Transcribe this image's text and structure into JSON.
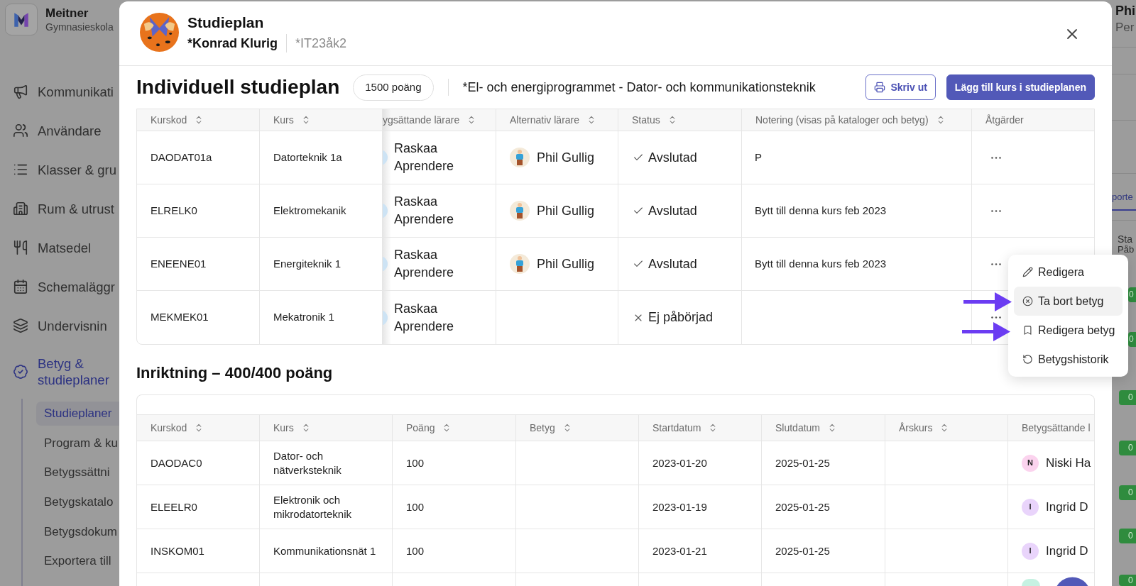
{
  "sidebar": {
    "school_name": "Meitner",
    "school_type": "Gymnasieskola",
    "items": [
      {
        "label": "Kommunikati",
        "selected": false
      },
      {
        "label": "Användare",
        "selected": false
      },
      {
        "label": "Klasser & gru",
        "selected": false
      },
      {
        "label": "Rum & utrust",
        "selected": false
      },
      {
        "label": "Matsedel",
        "selected": false
      },
      {
        "label": "Schemaläggr",
        "selected": false
      },
      {
        "label": "Undervisnin",
        "selected": false
      },
      {
        "label": "Betyg & studieplaner",
        "selected": true,
        "children": [
          {
            "label": "Studieplaner",
            "selected": true
          },
          {
            "label": "Program & ku",
            "selected": false
          },
          {
            "label": "Betygssättni",
            "selected": false
          },
          {
            "label": "Betygskatalo",
            "selected": false
          },
          {
            "label": "Betygsdokum",
            "selected": false
          },
          {
            "label": "Exportera till",
            "selected": false
          }
        ]
      }
    ]
  },
  "dialog": {
    "title": "Studieplan",
    "student": "*Konrad Klurig",
    "class": "*IT23åk2",
    "plan_title": "Individuell studieplan",
    "points": "1500 poäng",
    "program": "*El- och energiprogrammet - Dator- och kommunikationsteknik",
    "buttons": [
      {
        "label": "Skriv ut",
        "kind": "outline"
      },
      {
        "label": "Lägg till kurs i studieplanen",
        "kind": "primary"
      }
    ]
  },
  "courses_table": {
    "columns": [
      {
        "label": "Kurskod",
        "sortable": true
      },
      {
        "label": "Kurs",
        "sortable": true
      },
      {
        "label": "ygsättande lärare",
        "sortable": true
      },
      {
        "label": "Alternativ lärare",
        "sortable": true
      },
      {
        "label": "Status",
        "sortable": true
      },
      {
        "label": "Notering (visas på kataloger och betyg)",
        "sortable": true
      },
      {
        "label": "Åtgärder",
        "sortable": false
      }
    ],
    "rows": [
      {
        "code": "DAODAT01a",
        "course": "Datorteknik 1a",
        "teacher": "Raskaa Aprendere",
        "alt_teacher": "Phil Gullig",
        "status": {
          "kind": "done",
          "label": "Avslutad"
        },
        "note": "P"
      },
      {
        "code": "ELRELK0",
        "course": "Elektromekanik",
        "teacher": "Raskaa Aprendere",
        "alt_teacher": "Phil Gullig",
        "status": {
          "kind": "done",
          "label": "Avslutad"
        },
        "note": "Bytt till denna kurs feb 2023"
      },
      {
        "code": "ENEENE01",
        "course": "Energiteknik 1",
        "teacher": "Raskaa Aprendere",
        "alt_teacher": "Phil Gullig",
        "status": {
          "kind": "done",
          "label": "Avslutad"
        },
        "note": "Bytt till denna kurs feb 2023"
      },
      {
        "code": "MEKMEK01",
        "course": "Mekatronik 1",
        "teacher": "Raskaa Aprendere",
        "status": {
          "kind": "not_started",
          "label": "Ej påbörjad"
        }
      }
    ]
  },
  "row_menu": {
    "items": [
      {
        "label": "Redigera",
        "selected": false
      },
      {
        "label": "Ta bort betyg",
        "selected": true
      },
      {
        "label": "Redigera betyg",
        "selected": false
      },
      {
        "label": "Betygshistorik",
        "selected": false
      }
    ]
  },
  "inriktning": {
    "title": "Inriktning – 400/400 poäng",
    "columns": [
      {
        "label": "Kurskod",
        "sortable": true
      },
      {
        "label": "Kurs",
        "sortable": true
      },
      {
        "label": "Poäng",
        "sortable": true
      },
      {
        "label": "Betyg",
        "sortable": true
      },
      {
        "label": "Startdatum",
        "sortable": true
      },
      {
        "label": "Slutdatum",
        "sortable": true
      },
      {
        "label": "Årskurs",
        "sortable": true
      },
      {
        "label": "Betygsättande l",
        "sortable": false
      }
    ],
    "rows": [
      {
        "code": "DAODAC0",
        "course": "Dator- och nätverksteknik",
        "points": "100",
        "start": "2023-01-20",
        "end": "2025-01-25",
        "teacher": {
          "initial": "N",
          "name": "Niski Ha",
          "color": "#fbd3ee"
        }
      },
      {
        "code": "ELEELR0",
        "course": "Elektronik och mikrodatorteknik",
        "points": "100",
        "start": "2023-01-19",
        "end": "2025-01-25",
        "teacher": {
          "initial": "I",
          "name": "Ingrid D",
          "color": "#e9d4fb"
        }
      },
      {
        "code": "INSKOM01",
        "course": "Kommunikationsnät 1",
        "points": "100",
        "start": "2023-01-21",
        "end": "2025-01-25",
        "teacher": {
          "initial": "I",
          "name": "Ingrid D",
          "color": "#e9d4fb"
        }
      },
      {
        "teacher": {
          "color": "#c6f1e2"
        }
      }
    ]
  },
  "background_panel": {
    "name": "Phi",
    "role": "Per",
    "tab": {
      "label": "porte",
      "selected": true
    },
    "status_label": "Sta",
    "status_value": "Påb",
    "badges": [
      "0",
      "0",
      "0",
      "0",
      "0",
      "0",
      "0"
    ]
  }
}
